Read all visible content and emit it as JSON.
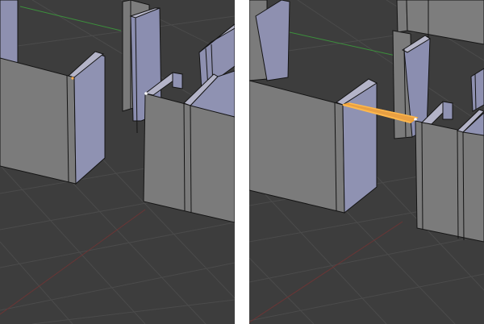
{
  "screens": [
    {
      "id": "before",
      "description_state": "single-vertex-selected"
    },
    {
      "id": "after",
      "description_state": "bridge-face-selected"
    }
  ],
  "colors": {
    "background": "#3d3d3d",
    "grid": "#4a4a4a",
    "x_axis": "#7a3a3a",
    "y_axis": "#3c8f3c",
    "wall_front": "#7b7b7b",
    "wall_side": "#8f92b2",
    "wall_top": "#b4b4c8",
    "edge": "#141414",
    "selection": "#f0a030",
    "vertex_selected": "#ffffff"
  }
}
